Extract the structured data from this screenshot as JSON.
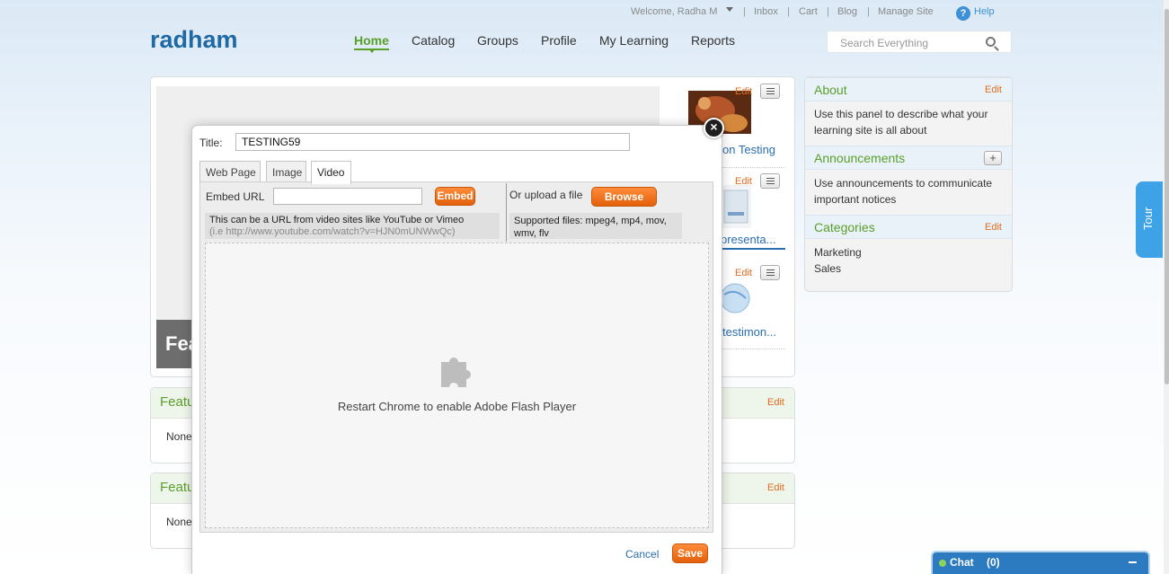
{
  "header": {
    "welcome": "Welcome, Radha M",
    "inbox": "Inbox",
    "cart": "Cart",
    "blog": "Blog",
    "manage_site": "Manage Site",
    "help_icon": "?",
    "help": "Help",
    "separator": "|"
  },
  "logo": "radham",
  "nav": [
    "Home",
    "Catalog",
    "Groups",
    "Profile",
    "My Learning",
    "Reports"
  ],
  "search": {
    "placeholder": "Search Everything"
  },
  "feature": {
    "caption": "Fea",
    "items": [
      {
        "edit": "Edit",
        "title": "on Testing"
      },
      {
        "edit": "Edit",
        "title": "presenta..."
      },
      {
        "edit": "Edit",
        "title": "testimon..."
      }
    ]
  },
  "featured_panels": [
    {
      "title": "Featu",
      "edit": "Edit",
      "body": "None"
    },
    {
      "title": "Featu",
      "edit": "Edit",
      "body": "None"
    }
  ],
  "sidebar": {
    "about": {
      "title": "About",
      "edit": "Edit",
      "body": "Use this panel to describe what your learning site is all about"
    },
    "announcements": {
      "title": "Announcements",
      "add": "+",
      "body": "Use announcements to communicate important notices"
    },
    "categories": {
      "title": "Categories",
      "edit": "Edit",
      "items": [
        "Marketing",
        "Sales"
      ]
    }
  },
  "tour": "Tour",
  "chat": {
    "label": "Chat",
    "count": "(0)"
  },
  "modal": {
    "close": "×",
    "title_label": "Title:",
    "title_value": "TESTING59",
    "tabs": [
      "Web Page",
      "Image",
      "Video"
    ],
    "active_tab": "Video",
    "embed_label": "Embed URL",
    "embed_value": "",
    "embed_button": "Embed",
    "upload_label": "Or upload a file",
    "browse_button": "Browse",
    "embed_hint": "This can be a URL from video sites like YouTube or Vimeo",
    "embed_example": "(i.e http://www.youtube.com/watch?v=HJN0mUNWwQc)",
    "supported_files": "Supported files: mpeg4, mp4, mov, wmv, flv",
    "plugin_message": "Restart Chrome to enable Adobe Flash Player",
    "cancel": "Cancel",
    "save": "Save"
  },
  "colors": {
    "accent_green": "#5a9f2a",
    "link_blue": "#2a6eb0",
    "button_orange": "#e2600b",
    "tour_blue": "#3ea2e6"
  }
}
